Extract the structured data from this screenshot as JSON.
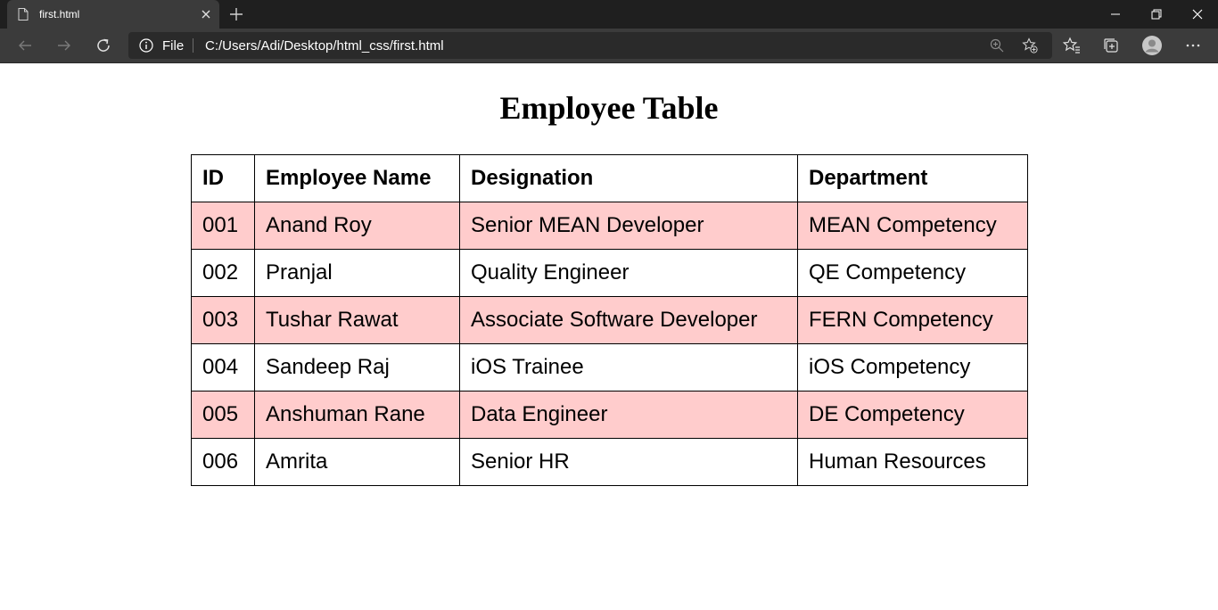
{
  "browser": {
    "tab_title": "first.html",
    "address_scheme": "File",
    "address_url": "C:/Users/Adi/Desktop/html_css/first.html"
  },
  "icons": {
    "tab": "document-icon",
    "close": "close-icon",
    "new_tab": "plus-icon",
    "back": "back-arrow-icon",
    "forward": "forward-arrow-icon",
    "refresh": "refresh-icon",
    "info": "info-icon",
    "zoom": "zoom-icon",
    "add_favorite": "star-plus-icon",
    "favorites": "favorites-icon",
    "collections": "collections-icon",
    "profile": "profile-icon",
    "more": "more-icon"
  },
  "page": {
    "title": "Employee Table",
    "row_highlight_color": "#ffcccc"
  },
  "table": {
    "headers": [
      "ID",
      "Employee Name",
      "Designation",
      "Department"
    ],
    "rows": [
      [
        "001",
        "Anand Roy",
        "Senior MEAN Developer",
        "MEAN Competency"
      ],
      [
        "002",
        "Pranjal",
        "Quality Engineer",
        "QE Competency"
      ],
      [
        "003",
        "Tushar Rawat",
        "Associate Software Developer",
        "FERN Competency"
      ],
      [
        "004",
        "Sandeep Raj",
        "iOS Trainee",
        "iOS Competency"
      ],
      [
        "005",
        "Anshuman Rane",
        "Data Engineer",
        "DE Competency"
      ],
      [
        "006",
        "Amrita",
        "Senior HR",
        "Human Resources"
      ]
    ]
  }
}
